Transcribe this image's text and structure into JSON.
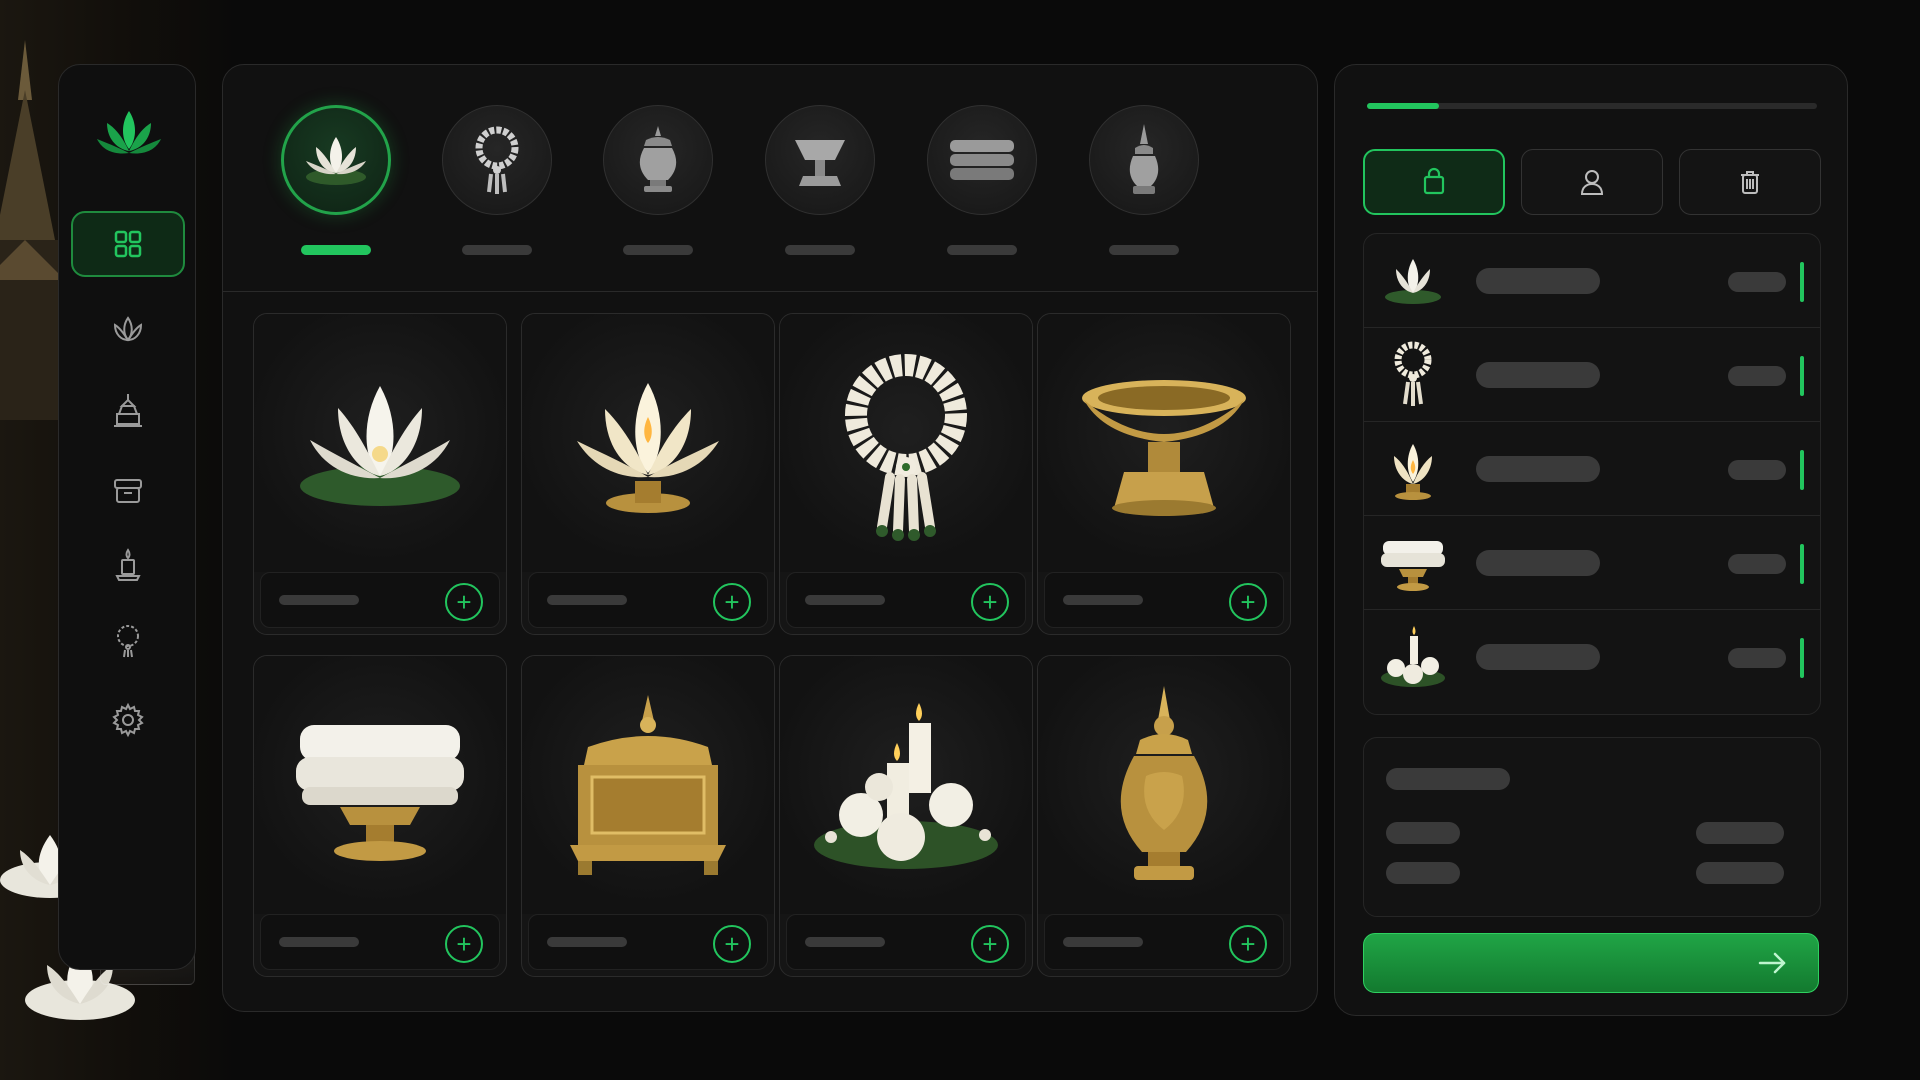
{
  "theme": {
    "accent": "#22c55e",
    "background": "#0a0a0a",
    "panel": "#111111",
    "gold": "#c9a24a",
    "ivory": "#f2efe4"
  },
  "logo": {
    "icon": "lotus-logo-icon"
  },
  "sidebar": {
    "items": [
      {
        "id": "dashboard",
        "icon": "grid-icon",
        "active": true
      },
      {
        "id": "flowers",
        "icon": "lotus-icon",
        "active": false
      },
      {
        "id": "offerings",
        "icon": "pagoda-icon",
        "active": false
      },
      {
        "id": "boxes",
        "icon": "box-icon",
        "active": false
      },
      {
        "id": "candles",
        "icon": "candle-icon",
        "active": false
      },
      {
        "id": "garlands",
        "icon": "garland-icon",
        "active": false
      },
      {
        "id": "settings",
        "icon": "gear-icon",
        "active": false
      }
    ]
  },
  "categories": [
    {
      "id": "lotus",
      "icon": "lotus-icon",
      "active": true
    },
    {
      "id": "garland",
      "icon": "garland-icon",
      "active": false
    },
    {
      "id": "urn",
      "icon": "urn-icon",
      "active": false
    },
    {
      "id": "pedestal-bowl",
      "icon": "pedestal-bowl-icon",
      "active": false
    },
    {
      "id": "cloth",
      "icon": "folded-cloth-icon",
      "active": false
    },
    {
      "id": "stupa-vase",
      "icon": "stupa-vase-icon",
      "active": false
    }
  ],
  "products": [
    {
      "id": "lotus-flower",
      "image": "white-lotus"
    },
    {
      "id": "lotus-lamp",
      "image": "lotus-candle-lamp"
    },
    {
      "id": "jasmine-garland",
      "image": "jasmine-garland"
    },
    {
      "id": "gold-bowl",
      "image": "golden-pedestal-bowl"
    },
    {
      "id": "white-cloth",
      "image": "folded-white-cloth-on-tray"
    },
    {
      "id": "gold-box",
      "image": "ornate-golden-box"
    },
    {
      "id": "candle-arrangement",
      "image": "candles-with-white-roses"
    },
    {
      "id": "gold-urn",
      "image": "golden-urn"
    }
  ],
  "cart": {
    "progress": 0.16,
    "tabs": [
      {
        "id": "bag",
        "icon": "shopping-bag-icon",
        "active": true
      },
      {
        "id": "user",
        "icon": "user-icon",
        "active": false
      },
      {
        "id": "delete",
        "icon": "trash-icon",
        "active": false
      }
    ],
    "items": [
      {
        "id": "lotus-flower",
        "image": "white-lotus"
      },
      {
        "id": "jasmine-garland",
        "image": "jasmine-garland"
      },
      {
        "id": "lotus-lamp",
        "image": "lotus-candle-lamp"
      },
      {
        "id": "white-cloth",
        "image": "folded-white-cloth-on-tray"
      },
      {
        "id": "candle-arrangement",
        "image": "candles-with-white-roses"
      }
    ],
    "checkout": {
      "icon": "arrow-right-icon"
    }
  }
}
